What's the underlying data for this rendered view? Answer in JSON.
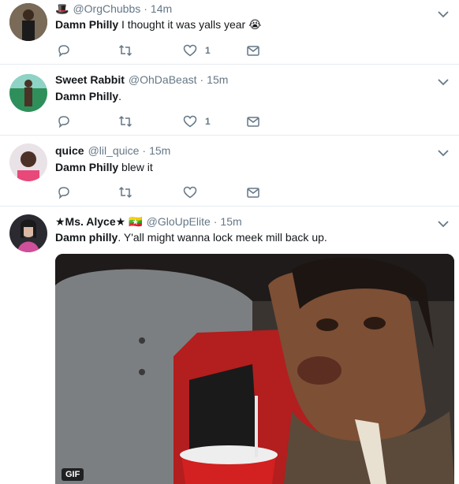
{
  "tweets": [
    {
      "name": "",
      "name_emoji": "🎩",
      "handle": "@OrgChubbs",
      "time": "14m",
      "lead": "Damn Philly",
      "rest": " I thought it was yalls year 😭",
      "like_count": "1"
    },
    {
      "name": "Sweet Rabbit",
      "handle": "@OhDaBeast",
      "time": "15m",
      "lead": "Damn Philly",
      "rest": ".",
      "like_count": "1"
    },
    {
      "name": "quice",
      "handle": "@lil_quice",
      "time": "15m",
      "lead": "Damn Philly",
      "rest": " blew it",
      "like_count": ""
    },
    {
      "name": "★Ms. Alyce★",
      "name_emoji": "🇲🇲",
      "handle": "@GloUpElite",
      "time": "15m",
      "lead": "Damn philly",
      "rest": ". Y'all might wanna lock meek mill back up.",
      "media_badge": "GIF"
    }
  ],
  "dot": "·",
  "icons": {
    "reply": "reply-icon",
    "retweet": "retweet-icon",
    "like": "heart-icon",
    "dm": "envelope-icon",
    "menu": "chevron-down-icon"
  },
  "colors": {
    "text": "#14171a",
    "secondary": "#657786",
    "divider": "#e6ecf0"
  }
}
